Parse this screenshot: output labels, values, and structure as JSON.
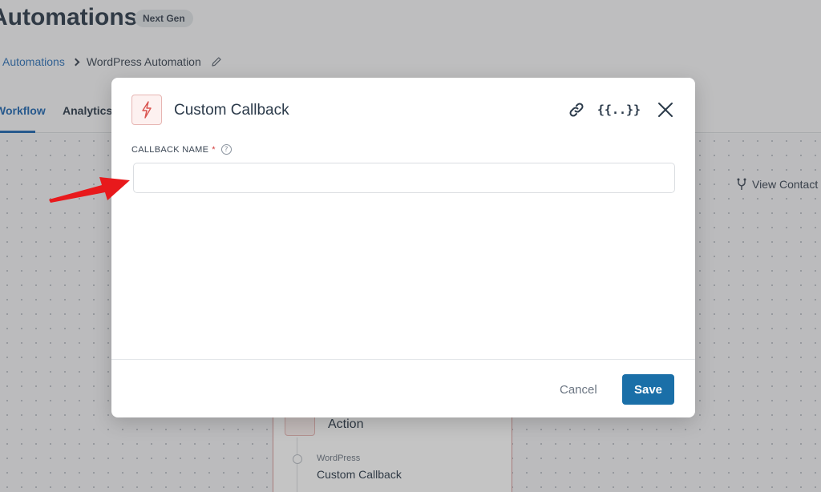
{
  "page": {
    "title": "Automations",
    "badge": "Next Gen",
    "breadcrumb": {
      "root": "Automations",
      "current": "WordPress Automation"
    },
    "tabs": [
      {
        "label": "Workflow"
      },
      {
        "label": "Analytics"
      }
    ],
    "view_contact": "View Contact"
  },
  "action_card": {
    "title": "Action",
    "subtitle": "WordPress",
    "name": "Custom Callback"
  },
  "modal": {
    "title": "Custom Callback",
    "merge_tags_icon": "{{..}}",
    "field": {
      "label": "CALLBACK NAME",
      "required_mark": "*",
      "help_glyph": "?",
      "value": ""
    },
    "cancel_label": "Cancel",
    "save_label": "Save"
  },
  "colors": {
    "accent": "#1a6fa8",
    "link": "#2f72b8",
    "icon_red": "#d9534f",
    "annotation_arrow": "#e8191c"
  },
  "icons": [
    "bolt-icon",
    "link-icon",
    "merge-tags-icon",
    "close-icon",
    "help-icon",
    "edit-pencil-icon",
    "chevron-right-icon",
    "branch-icon"
  ]
}
